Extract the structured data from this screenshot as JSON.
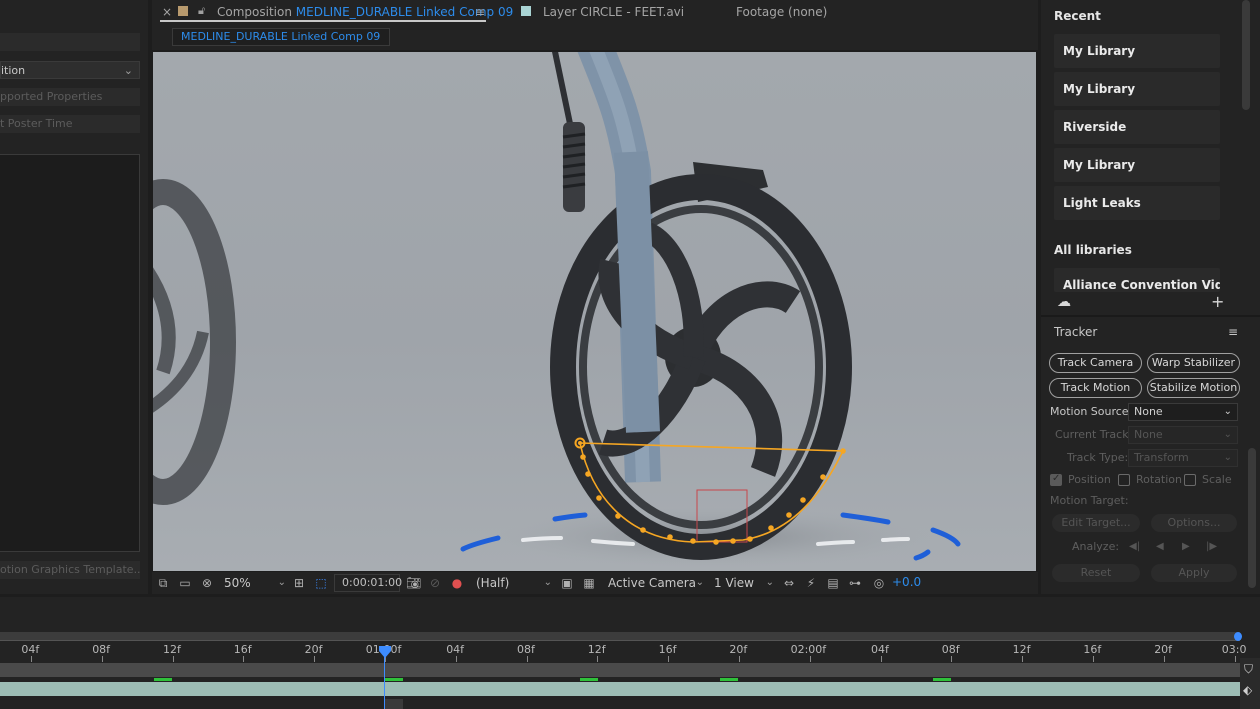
{
  "left_panel": {
    "select_value": "ition",
    "row1": "pported Properties",
    "row2": "t Poster Time",
    "footer": "otion Graphics Template..."
  },
  "comp_panel": {
    "tab_close": "×",
    "tab_prefix": "Composition",
    "comp_name": "MEDLINE_DURABLE Linked Comp 09",
    "tab_menu": "≡",
    "layer_tab": "Layer  CIRCLE - FEET.avi",
    "footage_tab": "Footage  (none)",
    "chip": "MEDLINE_DURABLE Linked Comp 09"
  },
  "viewer_toolbar": {
    "zoom": "50%",
    "timecode": "0:00:01:00",
    "resolution": "(Half)",
    "camera": "Active Camera",
    "views": "1 View",
    "exposure": "+0.0"
  },
  "libraries": {
    "recent_header": "Recent",
    "recent": [
      "My Library",
      "My Library",
      "Riverside",
      "My Library",
      "Light Leaks"
    ],
    "all_header": "All libraries",
    "all": [
      "Alliance Convention Video Ar..."
    ]
  },
  "tracker": {
    "title": "Tracker",
    "buttons": [
      "Track Camera",
      "Warp Stabilizer",
      "Track Motion",
      "Stabilize Motion"
    ],
    "motion_source_label": "Motion Source:",
    "motion_source_value": "None",
    "current_track_label": "Current Track:",
    "current_track_value": "None",
    "track_type_label": "Track Type:",
    "track_type_value": "Transform",
    "position_label": "Position",
    "rotation_label": "Rotation",
    "scale_label": "Scale",
    "motion_target_label": "Motion Target:",
    "edit_target": "Edit Target...",
    "options": "Options...",
    "analyze_label": "Analyze:",
    "reset": "Reset",
    "apply": "Apply"
  },
  "timeline": {
    "ticks": [
      "04f",
      "08f",
      "12f",
      "16f",
      "20f",
      "01:00f",
      "04f",
      "08f",
      "12f",
      "16f",
      "20f",
      "02:00f",
      "04f",
      "08f",
      "12f",
      "16f",
      "20f",
      "03:0"
    ]
  },
  "colors": {
    "accent_blue": "#2d8ceb",
    "mask_orange": "#f5a623",
    "keyframe_green": "#2fc13a",
    "layer_bar": "#9dbdb5"
  }
}
